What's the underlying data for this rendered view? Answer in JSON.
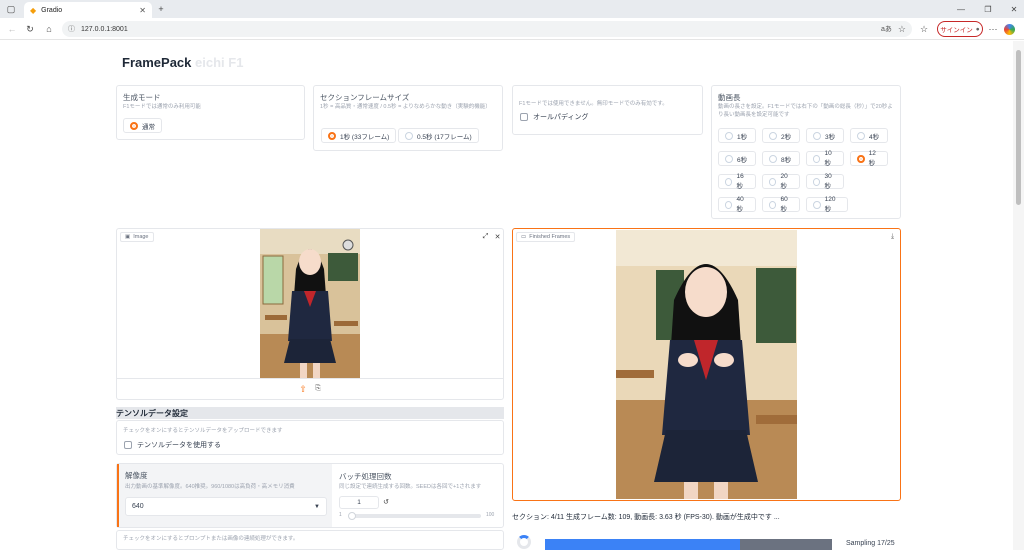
{
  "browser": {
    "tab_title": "Gradio",
    "url": "127.0.0.1:8001"
  },
  "app": {
    "title": "FramePack",
    "title_ghost": "eichi F1"
  },
  "gen_mode": {
    "label": "生成モード",
    "info": "F1モードでは通常のみ利用可能",
    "option": "通常"
  },
  "section_frame": {
    "label": "セクションフレームサイズ",
    "info": "1秒 = 高品質・通常速度 / 0.5秒 = よりなめらかな動き（実験的機能）",
    "options": [
      "1秒 (33フレーム)",
      "0.5秒 (17フレーム)"
    ]
  },
  "padding": {
    "info": "F1モードでは使用できません。無印モードでのみ有効です。",
    "label": "オールパディング"
  },
  "video_length": {
    "label": "動画長",
    "info": "動画の長さを設定。F1モードでは右下の「動画の総長（秒）」で20秒より長い動画長を設定可能です",
    "options": [
      "1秒",
      "2秒",
      "3秒",
      "4秒",
      "6秒",
      "8秒",
      "10秒",
      "12秒",
      "16秒",
      "20秒",
      "30秒",
      "40秒",
      "60秒",
      "120秒"
    ],
    "selected": "12秒"
  },
  "image_panel": {
    "label": "Image"
  },
  "tensor": {
    "header": "テンソルデータ設定",
    "info": "チェックをオンにするとテンソルデータをアップロードできます",
    "checkbox": "テンソルデータを使用する"
  },
  "resolution": {
    "label": "解像度",
    "info": "出力動画の基準解像度。640推奨。960/1080は高負荷・高メモリ消費",
    "value": "640"
  },
  "batch": {
    "label": "バッチ処理回数",
    "info": "同じ設定で連続生成する回数。SEEDは各回で+1されます",
    "value": "1",
    "min": "1",
    "max": "100"
  },
  "bottom_note": {
    "info": "チェックをオンにするとプロンプトまたは画像の連続処理ができます。"
  },
  "output": {
    "label": "Finished Frames",
    "status": "セクション: 4/11 生成フレーム数: 109, 動画長: 3.63 秒 (FPS-30). 動画が生成中です ...",
    "progress_label": "Sampling 17/25",
    "progress": 0.68
  },
  "colors": {
    "accent": "#f97316",
    "progress": "#3b82f6"
  }
}
